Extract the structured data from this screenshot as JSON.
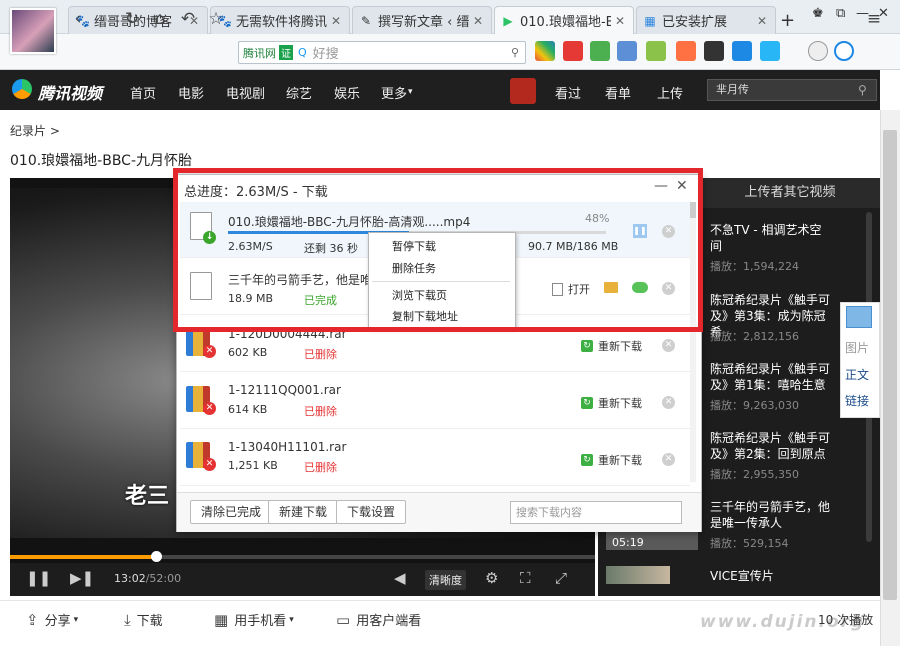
{
  "browser": {
    "tabs": [
      {
        "label": "缙哥哥的博客",
        "icon": "paw-icon"
      },
      {
        "label": "无需软件将腾讯",
        "icon": "paw-icon"
      },
      {
        "label": "撰写新文章 ‹ 缙",
        "icon": "pen-icon"
      },
      {
        "label": "010.琅嬛福地-B",
        "icon": "tencent-video-icon",
        "active": true
      },
      {
        "label": "已安装扩展",
        "icon": "extension-icon"
      }
    ],
    "new_tab": "+",
    "url_site": "腾讯网",
    "url_badge": "证",
    "search_placeholder": "好搜"
  },
  "tencent": {
    "brand": "腾讯视频",
    "nav": [
      "首页",
      "电影",
      "电视剧",
      "综艺",
      "娱乐",
      "更多"
    ],
    "right_nav": [
      "看过",
      "看单",
      "上传"
    ],
    "search_value": "芈月传"
  },
  "page": {
    "breadcrumb": "纪录片 >",
    "title": "010.琅嬛福地-BBC-九月怀胎"
  },
  "player": {
    "subtitle": "老三",
    "time_current": "13:02",
    "time_total": "/52:00",
    "progress": 0.25,
    "clarity": "清晰度"
  },
  "right_panel": {
    "header": "上传者其它视频",
    "items": [
      {
        "title": "不急TV - 相调艺术空间",
        "plays": "播放：1,594,224"
      },
      {
        "title": "陈冠希纪录片《触手可及》第3集：成为陈冠希",
        "plays": "播放：2,812,156"
      },
      {
        "title": "陈冠希纪录片《触手可及》第1集：嘻哈生意",
        "plays": "播放：9,263,030"
      },
      {
        "title": "陈冠希纪录片《触手可及》第2集：回到原点",
        "plays": "播放：2,955,350"
      },
      {
        "title": "三千年的弓箭手艺，他是唯一传承人",
        "plays": "播放：529,154"
      },
      {
        "title": "VICE宣传片",
        "plays": ""
      }
    ],
    "thumb_duration": "05:19"
  },
  "side_float": [
    "图片",
    "正文",
    "链接"
  ],
  "bottom": {
    "share": "分享",
    "download": "下载",
    "mobile": "用手机看",
    "client": "用客户端看",
    "plays": "10 次播放",
    "watermark": "www.dujin.org"
  },
  "download_dialog": {
    "title": "总进度：2.63M/S - 下载",
    "active": {
      "name": "010.琅嬛福地-BBC-九月怀胎-高清观.....mp4",
      "percent": "48%",
      "progress": 0.48,
      "speed": "2.63M/S",
      "remain": "还剩 36 秒",
      "size": "90.7 MB/186 MB"
    },
    "done": {
      "name": "三千年的弓箭手艺，他是唯一",
      "size": "18.9 MB",
      "status": "已完成",
      "open": "打开"
    },
    "deleted": [
      {
        "name": "1-120D0004444.rar",
        "size": "602 KB",
        "status": "已删除",
        "action": "重新下载"
      },
      {
        "name": "1-12111QQ001.rar",
        "size": "614 KB",
        "status": "已删除",
        "action": "重新下载"
      },
      {
        "name": "1-13040H11101.rar",
        "size": "1,251 KB",
        "status": "已删除",
        "action": "重新下载"
      }
    ],
    "footer": {
      "clear": "清除已完成",
      "new": "新建下载",
      "settings": "下载设置",
      "search_placeholder": "搜索下载内容"
    }
  },
  "context_menu": [
    "暂停下载",
    "删除任务",
    "浏览下载页",
    "复制下载地址"
  ],
  "colors": {
    "accent": "#2e86de",
    "orange": "#ff9c00",
    "highlight": "#e4262d"
  }
}
